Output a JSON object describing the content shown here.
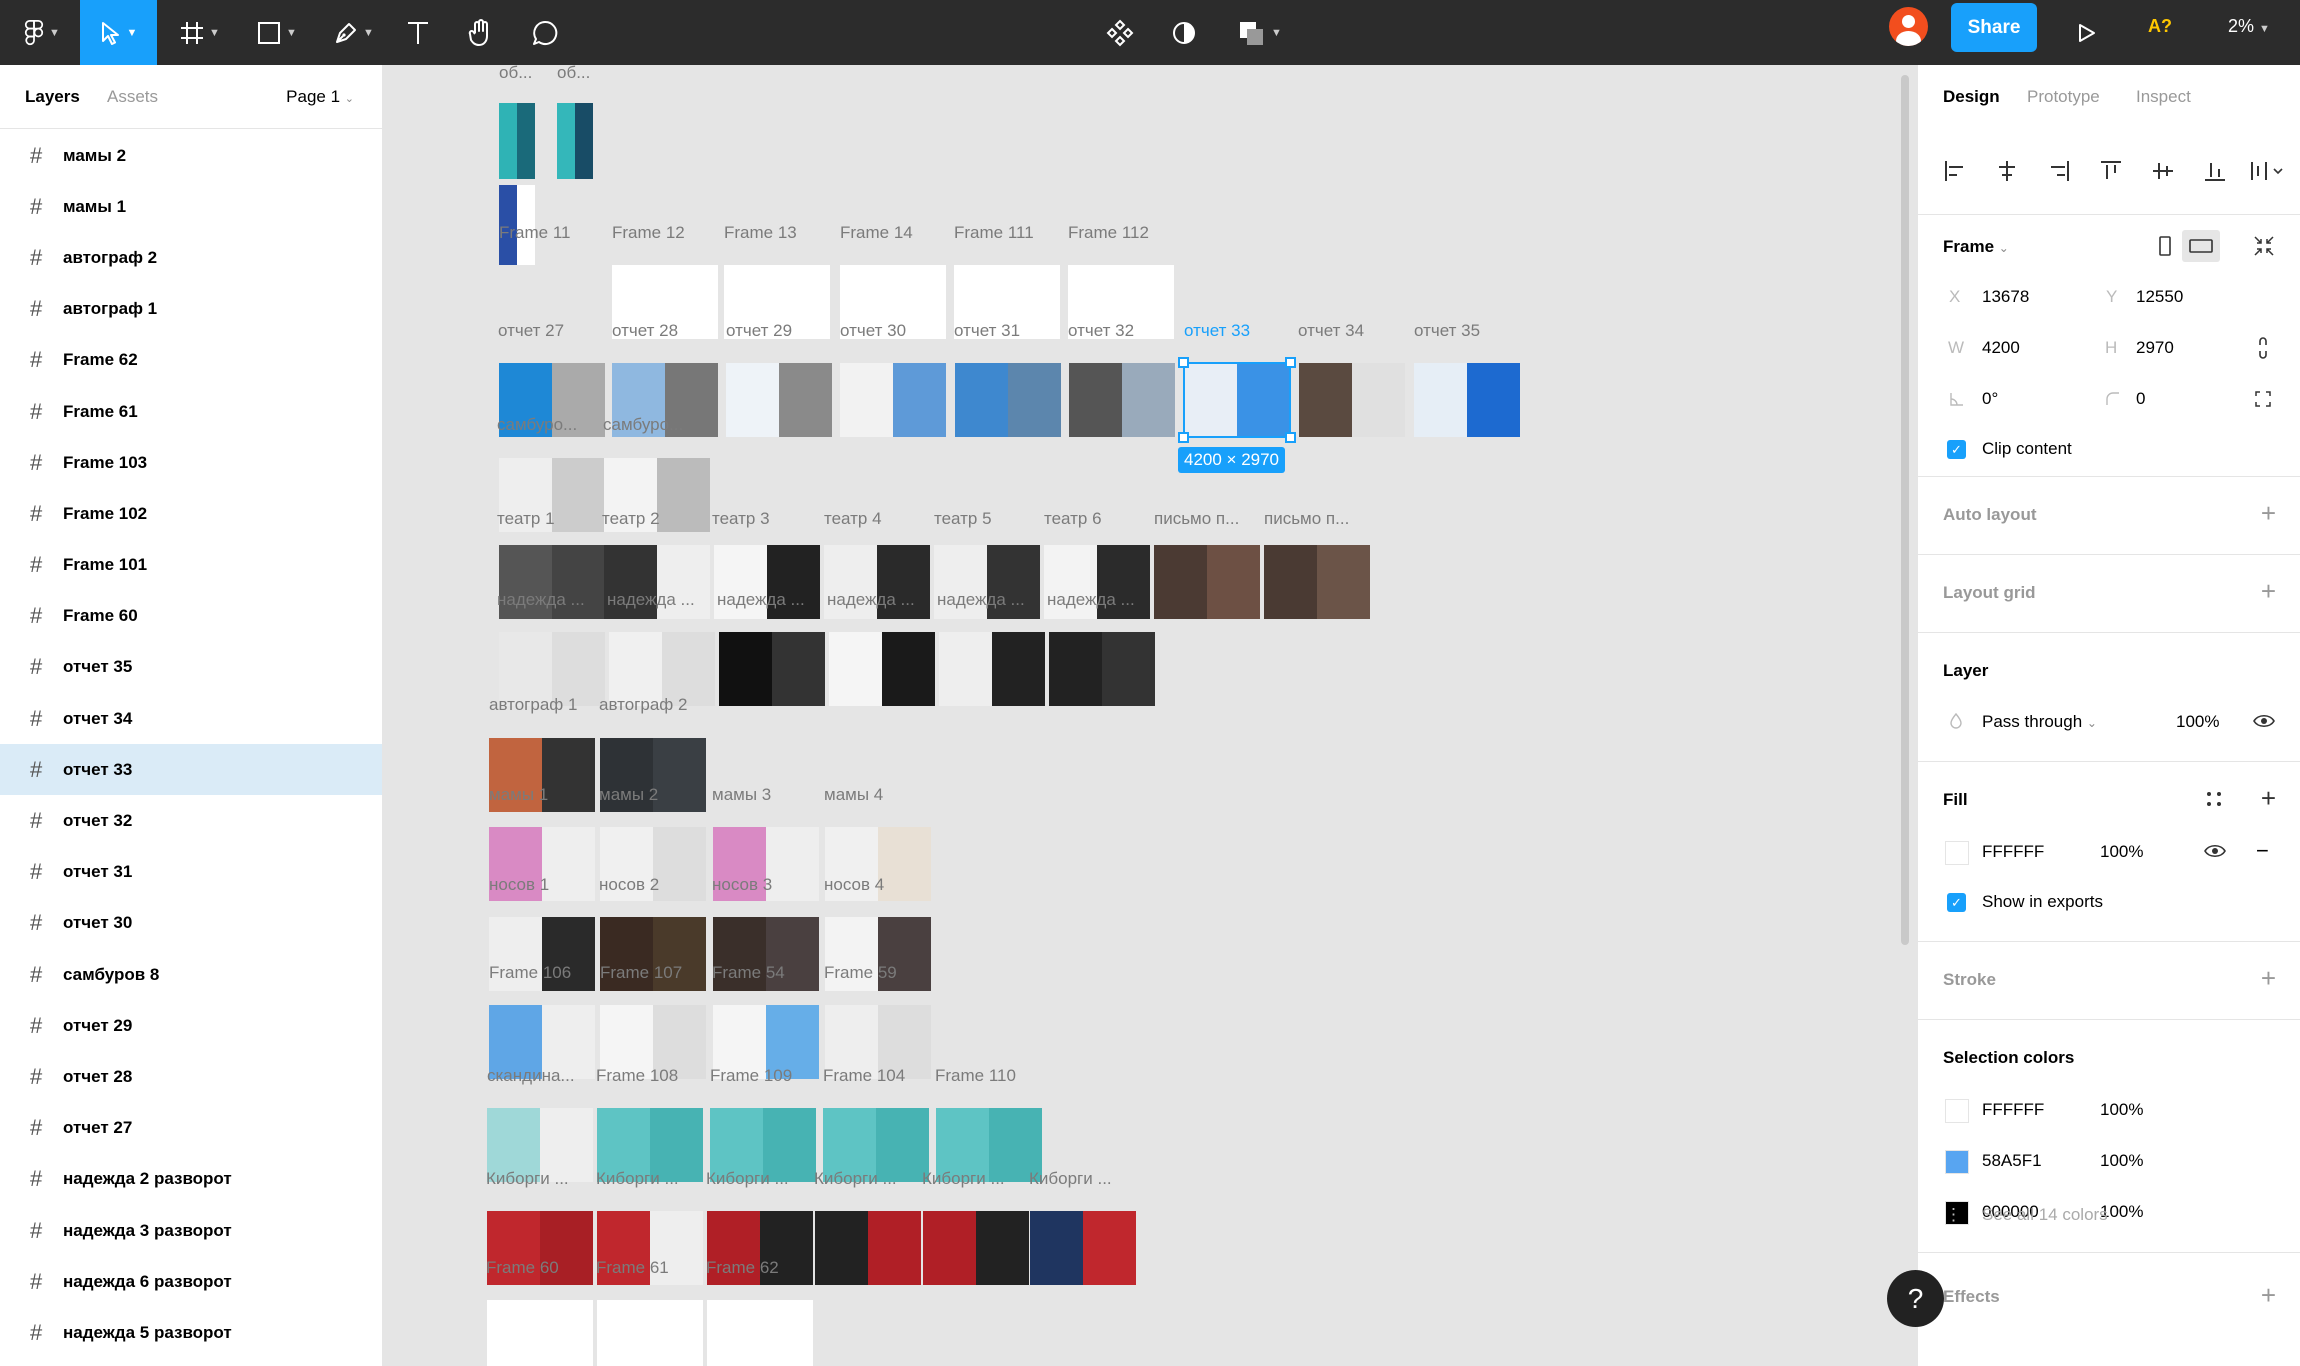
{
  "toolbar": {
    "share_label": "Share",
    "spell_label": "A?",
    "zoom_label": "2%",
    "tools": [
      "figma-menu-icon",
      "move-tool-icon",
      "frame-tool-icon",
      "shape-tool-icon",
      "pen-tool-icon",
      "text-tool-icon",
      "hand-tool-icon",
      "comment-tool-icon"
    ],
    "center_tools": [
      "components-icon",
      "mask-icon",
      "boolean-icon"
    ]
  },
  "left_panel": {
    "tab_layers": "Layers",
    "tab_assets": "Assets",
    "page": "Page 1",
    "layers": [
      {
        "name": "мамы 2"
      },
      {
        "name": "мамы 1"
      },
      {
        "name": "автограф 2"
      },
      {
        "name": "автограф 1"
      },
      {
        "name": "Frame 62"
      },
      {
        "name": "Frame 61"
      },
      {
        "name": "Frame 103"
      },
      {
        "name": "Frame 102"
      },
      {
        "name": "Frame 101"
      },
      {
        "name": "Frame 60"
      },
      {
        "name": "отчет 35"
      },
      {
        "name": "отчет 34"
      },
      {
        "name": "отчет 33",
        "selected": true
      },
      {
        "name": "отчет 32"
      },
      {
        "name": "отчет 31"
      },
      {
        "name": "отчет 30"
      },
      {
        "name": "самбуров 8"
      },
      {
        "name": "отчет 29"
      },
      {
        "name": "отчет 28"
      },
      {
        "name": "отчет 27"
      },
      {
        "name": "надежда 2 разворот"
      },
      {
        "name": "надежда 3 разворот"
      },
      {
        "name": "надежда 6 разворот"
      },
      {
        "name": "надежда 5 разворот"
      }
    ]
  },
  "canvas": {
    "selection_size": "4200 × 2970",
    "labels": [
      "об...",
      "об...",
      "Frame 11",
      "Frame 12",
      "Frame 13",
      "Frame 14",
      "Frame 111",
      "Frame 112",
      "отчет 27",
      "отчет 28",
      "отчет 29",
      "отчет 30",
      "отчет 31",
      "отчет 32",
      "отчет 33",
      "отчет 34",
      "отчет 35",
      "самбуро...",
      "самбуро...",
      "театр 1",
      "театр 2",
      "театр 3",
      "театр 4",
      "театр 5",
      "театр 6",
      "письмо п...",
      "письмо п...",
      "надежда ...",
      "надежда ...",
      "надежда ...",
      "надежда ...",
      "надежда ...",
      "надежда ...",
      "автограф 1",
      "автограф 2",
      "мамы 1",
      "мамы 2",
      "мамы 3",
      "мамы 4",
      "носов 1",
      "носов 2",
      "носов 3",
      "носов 4",
      "Frame 106",
      "Frame 107",
      "Frame 54",
      "Frame 59",
      "скандина...",
      "Frame 108",
      "Frame 109",
      "Frame 104",
      "Frame 110",
      "Киборги ...",
      "Киборги ...",
      "Киборги ...",
      "Киборги ...",
      "Киборги ...",
      "Киборги ...",
      "Frame 60",
      "Frame 61",
      "Frame 62"
    ]
  },
  "right_panel": {
    "tab_design": "Design",
    "tab_prototype": "Prototype",
    "tab_inspect": "Inspect",
    "frame_title": "Frame",
    "x_label": "X",
    "x_value": "13678",
    "y_label": "Y",
    "y_value": "12550",
    "w_label": "W",
    "w_value": "4200",
    "h_label": "H",
    "h_value": "2970",
    "rotation": "0°",
    "radius": "0",
    "clip_content": "Clip content",
    "auto_layout": "Auto layout",
    "layout_grid": "Layout grid",
    "layer_title": "Layer",
    "blend_mode": "Pass through",
    "layer_opacity": "100%",
    "fill_title": "Fill",
    "fill_hex": "FFFFFF",
    "fill_opacity": "100%",
    "show_in_exports": "Show in exports",
    "stroke_title": "Stroke",
    "selection_colors_title": "Selection colors",
    "selection_colors": [
      {
        "hex": "FFFFFF",
        "opacity": "100%",
        "color": "#FFFFFF"
      },
      {
        "hex": "58A5F1",
        "opacity": "100%",
        "color": "#58A5F1"
      },
      {
        "hex": "000000",
        "opacity": "100%",
        "color": "#000000"
      }
    ],
    "see_all": "See all 14 colors",
    "effects_title": "Effects"
  },
  "colors": {
    "accent": "#18a0fb",
    "toolbar_bg": "#2c2c2c",
    "selected_layer_bg": "#daebf7"
  }
}
